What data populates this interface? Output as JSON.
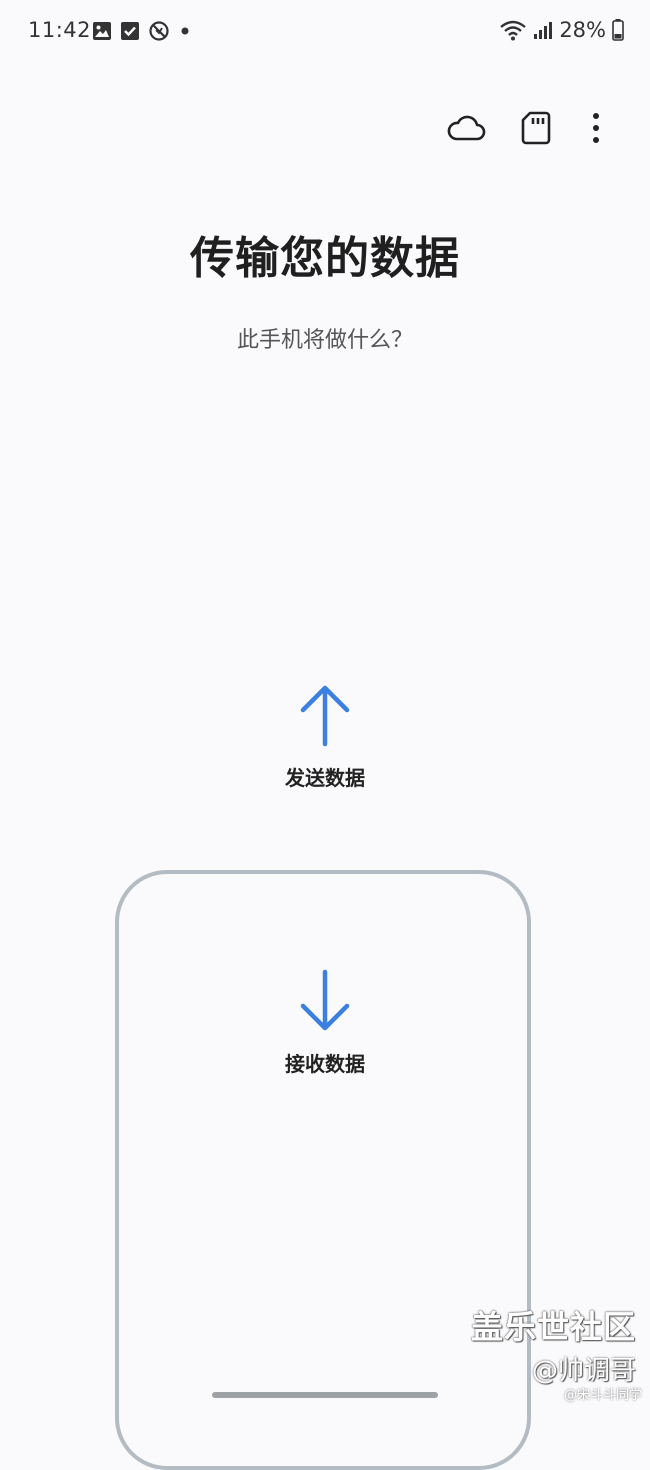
{
  "status_bar": {
    "time": "11:42",
    "battery": "28%",
    "left_icons": [
      "gallery-icon",
      "checkbox-icon",
      "block-icon",
      "dot-icon"
    ],
    "right_icons": [
      "wifi-icon",
      "signal-icon",
      "battery-icon"
    ]
  },
  "toolbar": {
    "icons": [
      "cloud-icon",
      "sd-card-icon",
      "more-options-icon"
    ]
  },
  "page": {
    "title": "传输您的数据",
    "subtitle": "此手机将做什么？"
  },
  "options": {
    "send_label": "发送数据",
    "receive_label": "接收数据"
  },
  "colors": {
    "accent": "#3b7fe0",
    "outline": "#b4bcc3",
    "background": "#fafafc"
  },
  "watermark": {
    "line1": "盖乐世社区",
    "line2": "@帅调哥",
    "line3": "@宋斗斗同学"
  }
}
